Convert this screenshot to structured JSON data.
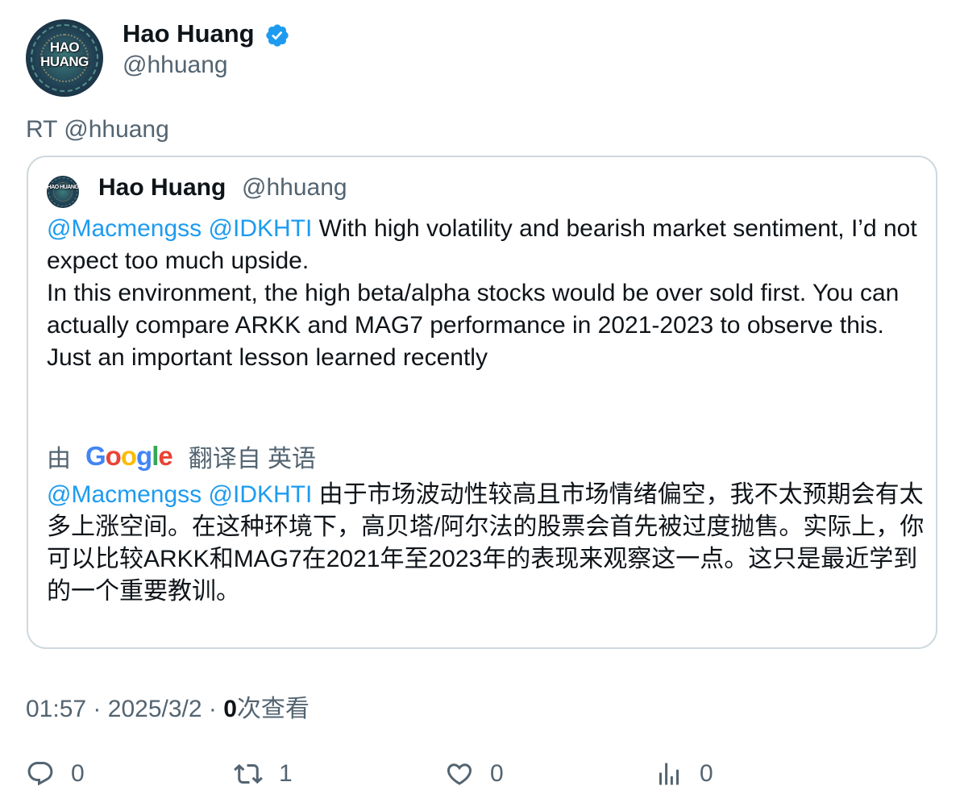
{
  "author": {
    "display_name": "Hao Huang",
    "handle": "@hhuang",
    "avatar_text": "HAO HUANG",
    "verified": true
  },
  "retweet_label": "RT @hhuang",
  "quoted": {
    "display_name": "Hao Huang",
    "handle": "@hhuang",
    "mention1": "@Macmengss",
    "mention2": "@IDKHTI",
    "body_line1": "With high volatility and bearish market sentiment, I’d not expect too much upside.",
    "body_line2": "In this environment, the high beta/alpha stocks would be over sold first. You can actually compare ARKK and MAG7 performance in 2021-2023 to observe this.",
    "body_line3": "Just an important lesson learned recently",
    "translation_prefix": "由",
    "translation_provider": "Google",
    "translation_suffix": "翻译自 英语",
    "translated_text": "由于市场波动性较高且市场情绪偏空，我不太预期会有太多上涨空间。在这种环境下，高贝塔/阿尔法的股票会首先被过度抛售。实际上，你可以比较ARKK和MAG7在2021年至2023年的表现来观察这一点。这只是最近学到的一个重要教训。"
  },
  "meta": {
    "time": "01:57",
    "separator": "·",
    "date": "2025/3/2",
    "views_count": "0",
    "views_label": "次查看"
  },
  "actions": {
    "replies": "0",
    "retweets": "1",
    "likes": "0",
    "views": "0"
  },
  "colors": {
    "link": "#1d9bf0",
    "secondary_text": "#536471",
    "primary_text": "#0f1419",
    "border": "#cfd9de",
    "verified_badge": "#1d9bf0"
  }
}
